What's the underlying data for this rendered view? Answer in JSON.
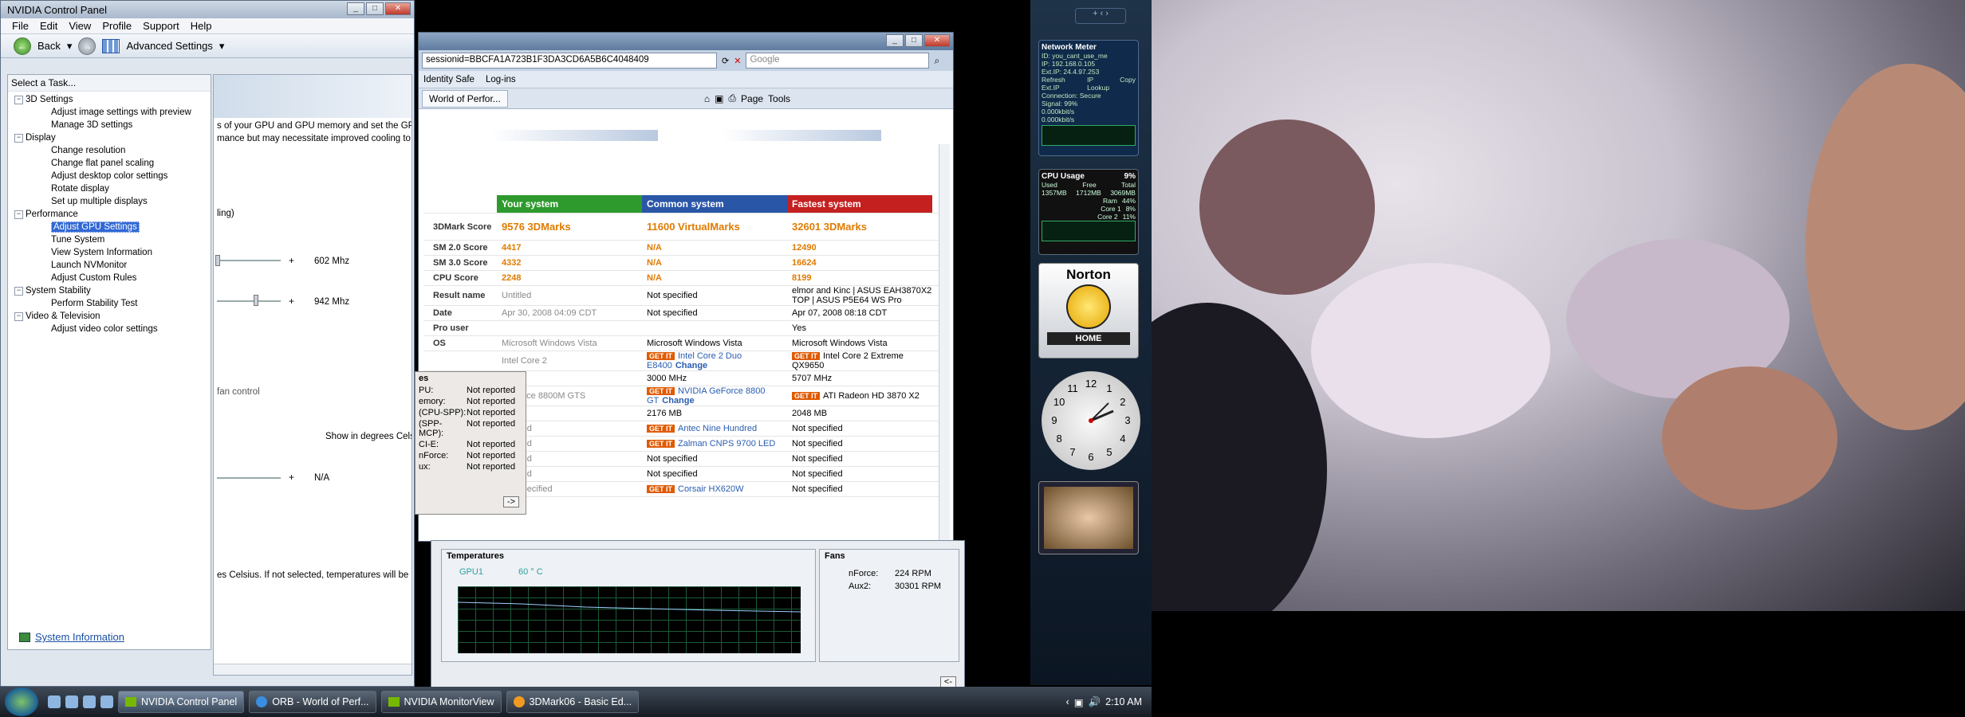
{
  "nvidia": {
    "title": "NVIDIA Control Panel",
    "menu": [
      "File",
      "Edit",
      "View",
      "Profile",
      "Support",
      "Help"
    ],
    "back_label": "Back",
    "advanced_label": "Advanced Settings",
    "task_header": "Select a Task...",
    "tree": [
      {
        "category": "3D Settings",
        "items": [
          "Adjust image settings with preview",
          "Manage 3D settings"
        ]
      },
      {
        "category": "Display",
        "items": [
          "Change resolution",
          "Change flat panel scaling",
          "Adjust desktop color settings",
          "Rotate display",
          "Set up multiple displays"
        ]
      },
      {
        "category": "Performance",
        "items": [
          "Adjust GPU Settings",
          "Tune System",
          "View System Information",
          "Launch NVMonitor",
          "Adjust Custom Rules"
        ]
      },
      {
        "category": "System Stability",
        "items": [
          "Perform Stability Test"
        ]
      },
      {
        "category": "Video & Television",
        "items": [
          "Adjust video color settings"
        ]
      }
    ],
    "selected_item": "Adjust GPU Settings",
    "system_info_link": "System Information",
    "pane_text_1": "s of your GPU and GPU memory and set the GPU fa",
    "pane_text_2": "mance but may necessitate improved cooling to main",
    "pane_text_3": "ling)",
    "slider1_value": "602 Mhz",
    "slider2_value": "942 Mhz",
    "fan_text": "fan control",
    "degrees_text": "Show in degrees Celsiu",
    "slider3_value": "N/A",
    "celsius_text": "es Celsius. If not selected, temperatures will be rep"
  },
  "ie": {
    "address": "sessionid=BBCFA1A723B1F3DA3CD6A5B6C4048409",
    "search_placeholder": "Google",
    "identity_safe": "Identity Safe",
    "logins": "Log-ins",
    "tab_label": "World of Perfor...",
    "page_label": "Page",
    "tools_label": "Tools",
    "columns": [
      "Your system",
      "Common system",
      "Fastest system"
    ],
    "column_colors": [
      "#2e9a2e",
      "#2a56a8",
      "#c42020"
    ],
    "score_label": "3DMark Score",
    "scores": [
      "9576 3DMarks",
      "11600 VirtualMarks",
      "32601 3DMarks"
    ],
    "rows": [
      {
        "label": "SM 2.0 Score",
        "your": "4417",
        "common": "N/A",
        "fast": "12490",
        "orange": true
      },
      {
        "label": "SM 3.0 Score",
        "your": "4332",
        "common": "N/A",
        "fast": "16624",
        "orange": true
      },
      {
        "label": "CPU Score",
        "your": "2248",
        "common": "N/A",
        "fast": "8199",
        "orange": true
      },
      {
        "label": "Result name",
        "your": "Untitled",
        "common": "Not specified",
        "fast": "elmor and Kinc | ASUS EAH3870X2 TOP | ASUS P5E64 WS Pro"
      },
      {
        "label": "Date",
        "your": "Apr 30, 2008 04:09 CDT",
        "common": "Not specified",
        "fast": "Apr 07, 2008 08:18 CDT"
      },
      {
        "label": "Pro user",
        "your": "",
        "common": "",
        "fast": "Yes"
      },
      {
        "label": "OS",
        "your": "Microsoft Windows Vista",
        "common": "Microsoft Windows Vista",
        "fast": "Microsoft Windows Vista"
      },
      {
        "label": "",
        "your": "Intel Core 2",
        "common": "Intel Core 2 Duo E8400",
        "fast": "Intel Core 2 Extreme QX9650",
        "getit": true
      },
      {
        "label": "",
        "your": "Hz",
        "common": "3000 MHz",
        "fast": "5707 MHz"
      },
      {
        "label": "",
        "your": "GeForce 8800M GTS",
        "common": "NVIDIA GeForce 8800 GT",
        "fast": "ATI Radeon HD 3870 X2",
        "getit": true
      },
      {
        "label": "",
        "your": "B",
        "common": "2176 MB",
        "fast": "2048 MB"
      },
      {
        "label": "",
        "your": "pecified",
        "common": "Antec Nine Hundred",
        "fast": "Not specified",
        "getit_common": true
      },
      {
        "label": "",
        "your": "pecified",
        "common": "Zalman CNPS 9700 LED",
        "fast": "Not specified",
        "getit_common": true
      },
      {
        "label": "",
        "your": "pecified",
        "common": "Not specified",
        "fast": "Not specified"
      },
      {
        "label": "",
        "your": "pecified",
        "common": "Not specified",
        "fast": "Not specified"
      },
      {
        "label": "",
        "your": "Not specified",
        "common": "Corsair HX620W",
        "fast": "Not specified",
        "getit_common": true
      }
    ],
    "change_label": "Change",
    "getit_label": "GET IT"
  },
  "popup": {
    "title": "es",
    "rows": [
      {
        "k": "PU:",
        "v": "Not reported"
      },
      {
        "k": "emory:",
        "v": "Not reported"
      },
      {
        "k": "(CPU-SPP):",
        "v": "Not reported"
      },
      {
        "k": "(SPP-MCP):",
        "v": "Not reported"
      },
      {
        "k": "CI-E:",
        "v": "Not reported"
      },
      {
        "k": "nForce:",
        "v": "Not reported"
      },
      {
        "k": "ux:",
        "v": "Not reported"
      }
    ],
    "next": "->"
  },
  "monitor": {
    "temps_title": "Temperatures",
    "gpu_label": "GPU1",
    "gpu_temp": "60 ° C",
    "fans_title": "Fans",
    "fans": [
      {
        "k": "nForce:",
        "v": "224 RPM"
      },
      {
        "k": "Aux2:",
        "v": "30301 RPM"
      }
    ],
    "back": "<-"
  },
  "sidebar": {
    "network_title": "Network Meter",
    "network_lines": [
      "ID: you_cant_use_me",
      "IP: 192.168.0.105",
      "Ext.IP: 24.4.97.253",
      "Connection: Secure",
      "Signal: 99%",
      "0.000kbit/s",
      "0.000kbit/s"
    ],
    "copy": "Copy",
    "refresh": "Refresh Ext.IP",
    "iplookup": "IP Lookup",
    "cpu_title": "CPU Usage",
    "cpu_pct": "9%",
    "cpu_used": "Used",
    "cpu_free": "Free",
    "cpu_total": "Total",
    "cpu_used_v": "1357MB",
    "cpu_free_v": "1712MB",
    "cpu_total_v": "3069MB",
    "ram_label": "Ram",
    "ram_v": "44%",
    "core1": "Core 1",
    "core1_v": "8%",
    "core2": "Core 2",
    "core2_v": "11%",
    "norton": "Norton",
    "home": "HOME",
    "clock_numbers": [
      "12",
      "1",
      "2",
      "3",
      "4",
      "5",
      "6",
      "7",
      "8",
      "9",
      "10",
      "11"
    ]
  },
  "taskbar": {
    "buttons": [
      "NVIDIA Control Panel",
      "ORB - World of Perf...",
      "NVIDIA MonitorView",
      "3DMark06 - Basic Ed..."
    ],
    "time": "2:10 AM"
  }
}
